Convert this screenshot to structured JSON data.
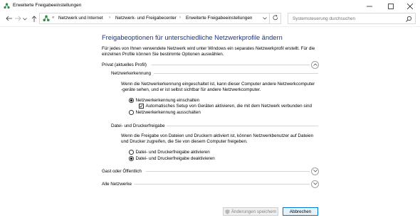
{
  "window": {
    "title": "Erweiterte Freigabeeinstellungen",
    "controls": [
      "minimize",
      "maximize",
      "close"
    ]
  },
  "nav": {
    "back_icon": "arrow-left-icon",
    "forward_icon": "arrow-right-icon",
    "recent_icon": "chevron-down-icon",
    "up_icon": "arrow-up-icon",
    "breadcrumbs": [
      "Netzwerk und Internet",
      "Netzwerk- und Freigabecenter",
      "Erweiterte Freigabeeinstellungen"
    ],
    "search_placeholder": "Systemsteuerung durchsuchen"
  },
  "main": {
    "heading": "Freigabeoptionen für unterschiedliche Netzwerkprofile ändern",
    "intro_lines": [
      "Für jedes von Ihnen verwendete Netzwerk wird unter Windows ein separates Netzwerkprofil erstellt. Für die",
      "einzelnen Profile können Sie bestimmte Optionen auswählen."
    ],
    "profiles": {
      "private": {
        "label": "Privat (aktuelles Profil)",
        "expanded": true,
        "discovery": {
          "title": "Netzwerkerkennung",
          "desc_lines": [
            "Wenn die Netzwerkerkennung eingeschaltet ist, kann dieser Computer andere Netzwerkcomputer",
            "-geräte sehen, und er ist selbst sichtbar für andere Netzwerkcomputer."
          ],
          "option_on": "Netzwerkerkennung einschalten",
          "option_auto": "Automatisches Setup von Geräten aktivieren, die mit dem Netzwerk verbunden sind",
          "option_off": "Netzwerkerkennung ausschalten",
          "selected": "on",
          "auto_checked": true
        },
        "sharing": {
          "title": "Datei- und Druckerfreigabe",
          "desc_lines": [
            "Wenn die Freigabe von Dateien und Druckern aktiviert ist, können Netzwerkbenutzer auf Dateien",
            "und Drucker zugreifen, die Sie von diesem Computer freigeben."
          ],
          "option_on": "Datei- und Druckerfreigabe aktivieren",
          "option_off": "Datei- und Druckerfreigabe deaktivieren",
          "selected": "off"
        }
      },
      "guest": {
        "label": "Gast oder Öffentlich",
        "expanded": false
      },
      "all": {
        "label": "Alle Netzwerke",
        "expanded": false
      }
    }
  },
  "footer": {
    "save_label": "Änderungen speichern",
    "save_enabled": false,
    "cancel_label": "Abbrechen"
  }
}
